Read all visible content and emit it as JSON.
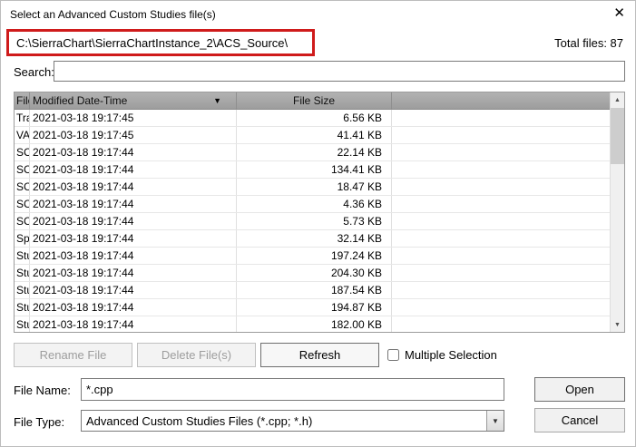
{
  "dialog": {
    "title": "Select an Advanced Custom Studies file(s)",
    "path": "C:\\SierraChart\\SierraChartInstance_2\\ACS_Source\\",
    "total_files": "Total files: 87",
    "search_label": "Search:",
    "search_value": ""
  },
  "icons": {
    "close": "✕",
    "sort_desc": "▼",
    "scroll_up": "▲",
    "scroll_down": "▼",
    "combo_arrow": "▼"
  },
  "annotation": {
    "color": "#cf1b1b",
    "purpose": "red highlight box around directory path"
  },
  "table": {
    "columns": [
      "File",
      "Modified Date-Time",
      "File Size",
      ""
    ],
    "rows": [
      {
        "file": "Tra",
        "modified": "2021-03-18 19:17:45",
        "size": "6.56 KB"
      },
      {
        "file": "VAF",
        "modified": "2021-03-18 19:17:45",
        "size": "41.41 KB"
      },
      {
        "file": "SCS",
        "modified": "2021-03-18 19:17:44",
        "size": "22.14 KB"
      },
      {
        "file": "SCS",
        "modified": "2021-03-18 19:17:44",
        "size": "134.41 KB"
      },
      {
        "file": "SCS",
        "modified": "2021-03-18 19:17:44",
        "size": "18.47 KB"
      },
      {
        "file": "SCS",
        "modified": "2021-03-18 19:17:44",
        "size": "4.36 KB"
      },
      {
        "file": "SC_",
        "modified": "2021-03-18 19:17:44",
        "size": "5.73 KB"
      },
      {
        "file": "Spr",
        "modified": "2021-03-18 19:17:44",
        "size": "32.14 KB"
      },
      {
        "file": "Stu",
        "modified": "2021-03-18 19:17:44",
        "size": "197.24 KB"
      },
      {
        "file": "Stu",
        "modified": "2021-03-18 19:17:44",
        "size": "204.30 KB"
      },
      {
        "file": "Stu",
        "modified": "2021-03-18 19:17:44",
        "size": "187.54 KB"
      },
      {
        "file": "Stu",
        "modified": "2021-03-18 19:17:44",
        "size": "194.87 KB"
      },
      {
        "file": "Stu",
        "modified": "2021-03-18 19:17:44",
        "size": "182.00 KB"
      }
    ]
  },
  "actions": {
    "rename": "Rename File",
    "delete": "Delete File(s)",
    "refresh": "Refresh",
    "multiple_selection": "Multiple Selection"
  },
  "footer": {
    "file_name_label": "File Name:",
    "file_name_value": "*.cpp",
    "file_type_label": "File Type:",
    "file_type_value": "Advanced Custom Studies Files (*.cpp; *.h)",
    "open": "Open",
    "cancel": "Cancel"
  }
}
